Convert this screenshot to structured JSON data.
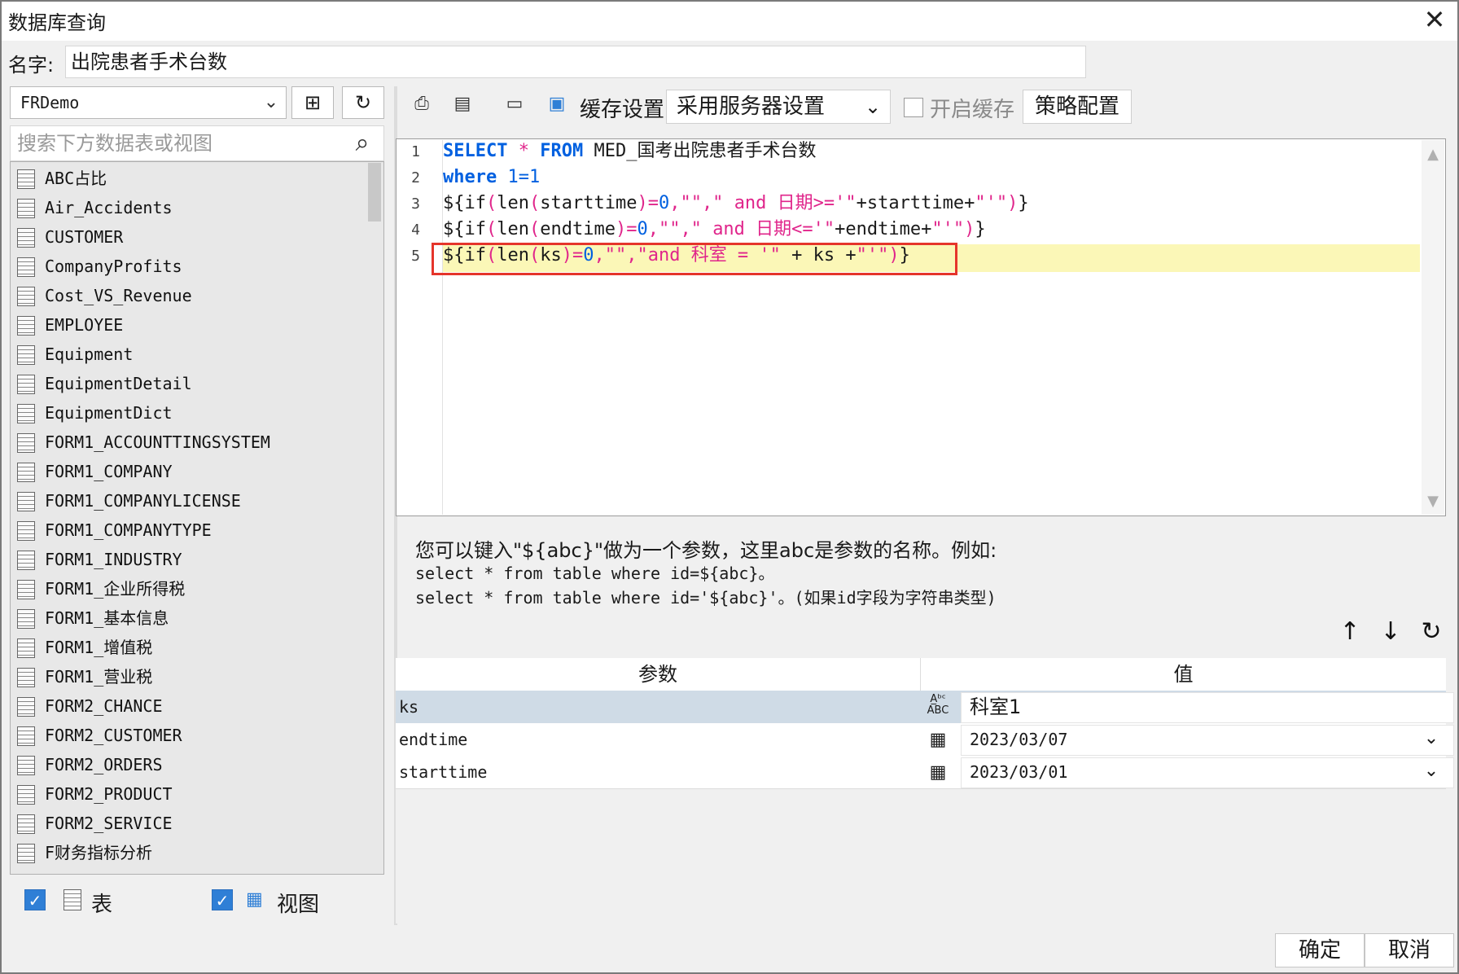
{
  "window": {
    "title": "数据库查询",
    "close": "✕"
  },
  "name_field": {
    "label": "名字:",
    "value": "出院患者手术台数"
  },
  "datasource": {
    "selected": "FRDemo"
  },
  "search": {
    "placeholder": "搜索下方数据表或视图"
  },
  "tables": [
    "ABC占比",
    "Air_Accidents",
    "CUSTOMER",
    "CompanyProfits",
    "Cost_VS_Revenue",
    "EMPLOYEE",
    "Equipment",
    "EquipmentDetail",
    "EquipmentDict",
    "FORM1_ACCOUNTTINGSYSTEM",
    "FORM1_COMPANY",
    "FORM1_COMPANYLICENSE",
    "FORM1_COMPANYTYPE",
    "FORM1_INDUSTRY",
    "FORM1_企业所得税",
    "FORM1_基本信息",
    "FORM1_增值税",
    "FORM1_营业税",
    "FORM2_CHANCE",
    "FORM2_CUSTOMER",
    "FORM2_ORDERS",
    "FORM2_PRODUCT",
    "FORM2_SERVICE",
    "F财务指标分析"
  ],
  "filters": {
    "table_label": "表",
    "view_label": "视图",
    "check": "✓"
  },
  "toolbar": {
    "cache_label": "缓存设置",
    "cache_mode": "采用服务器设置",
    "enable_cache": "开启缓存",
    "strategy": "策略配置"
  },
  "editor": {
    "line_numbers": [
      "1",
      "2",
      "3",
      "4",
      "5"
    ]
  },
  "help": {
    "line1": "您可以键入\"${abc}\"做为一个参数，这里abc是参数的名称。例如:",
    "line2": "select * from table where id=${abc}。",
    "line3": "select * from table where id='${abc}'。(如果id字段为字符串类型)"
  },
  "params": {
    "col_param": "参数",
    "col_value": "值",
    "rows": [
      {
        "name": "ks",
        "value": "科室1",
        "type_icon": "text-type-icon"
      },
      {
        "name": "endtime",
        "value": "2023/03/07",
        "type_icon": "calendar-icon"
      },
      {
        "name": "starttime",
        "value": "2023/03/01",
        "type_icon": "calendar-icon"
      }
    ]
  },
  "buttons": {
    "ok": "确定",
    "cancel": "取消"
  }
}
